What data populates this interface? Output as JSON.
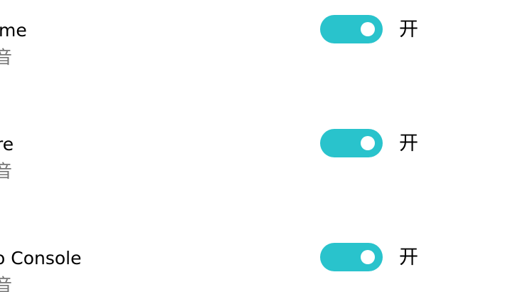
{
  "colors": {
    "toggle_on": "#29c3cc",
    "knob": "#ffffff",
    "title_text": "#000000",
    "subtitle_text": "#767676"
  },
  "settings": [
    {
      "title": "me",
      "subtitle": "音",
      "toggle_state": "on",
      "state_label": "开"
    },
    {
      "title": "re",
      "subtitle": "音",
      "toggle_state": "on",
      "state_label": "开"
    },
    {
      "title": "o Console",
      "subtitle": "音",
      "toggle_state": "on",
      "state_label": "开"
    }
  ]
}
